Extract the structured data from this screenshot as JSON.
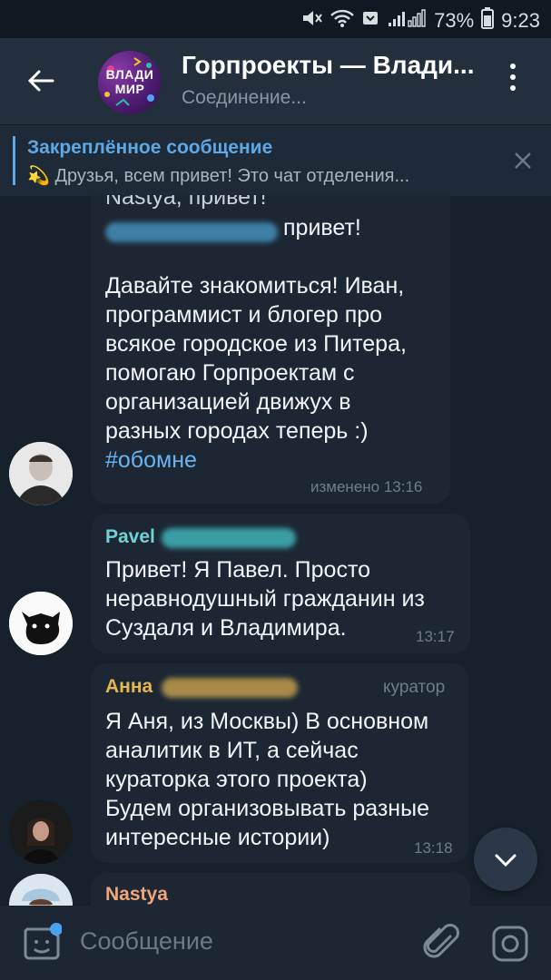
{
  "status_bar": {
    "battery": "73%",
    "time": "9:23"
  },
  "header": {
    "group_avatar_text": [
      "ВЛАДИ",
      "МИР"
    ],
    "title": "Горпроекты — Влади...",
    "subtitle": "Соединение..."
  },
  "pinned": {
    "label": "Закреплённое сообщение",
    "emoji": "💫",
    "text": "Друзья, всем привет!   Это чат отделения..."
  },
  "messages": [
    {
      "top_cut_text": "Nastya, привет!",
      "mention_suffix": "привет!",
      "body": [
        "Давайте знакомиться! Иван,",
        "программист и блогер про",
        "всякое городское из Питера,",
        "помогаю Горпроектам с",
        "организацией движух в",
        "разных городах теперь :)"
      ],
      "hashtag": "#обомне",
      "time": "изменено 13:16"
    },
    {
      "sender": "Pavel",
      "body": [
        "Привет! Я Павел. Просто",
        "неравнодушный гражданин из",
        "Суздаля и Владимира."
      ],
      "time": "13:17"
    },
    {
      "sender": "Анна",
      "role": "куратор",
      "body": [
        "Я Аня, из Москвы) В основном",
        "аналитик в ИТ, а сейчас",
        "кураторка этого проекта)",
        "Будем организовывать разные",
        "интересные истории)"
      ],
      "time": "13:18"
    },
    {
      "sender": "Nastya"
    }
  ],
  "composer": {
    "placeholder": "Сообщение"
  },
  "colors": {
    "background": "#17212b",
    "header": "#242f3d",
    "bubble": "#1c2733",
    "accent": "#5fa8e6",
    "pavel": "#6fd3d6",
    "anna": "#e5b54f",
    "nastya": "#f0a57a"
  }
}
